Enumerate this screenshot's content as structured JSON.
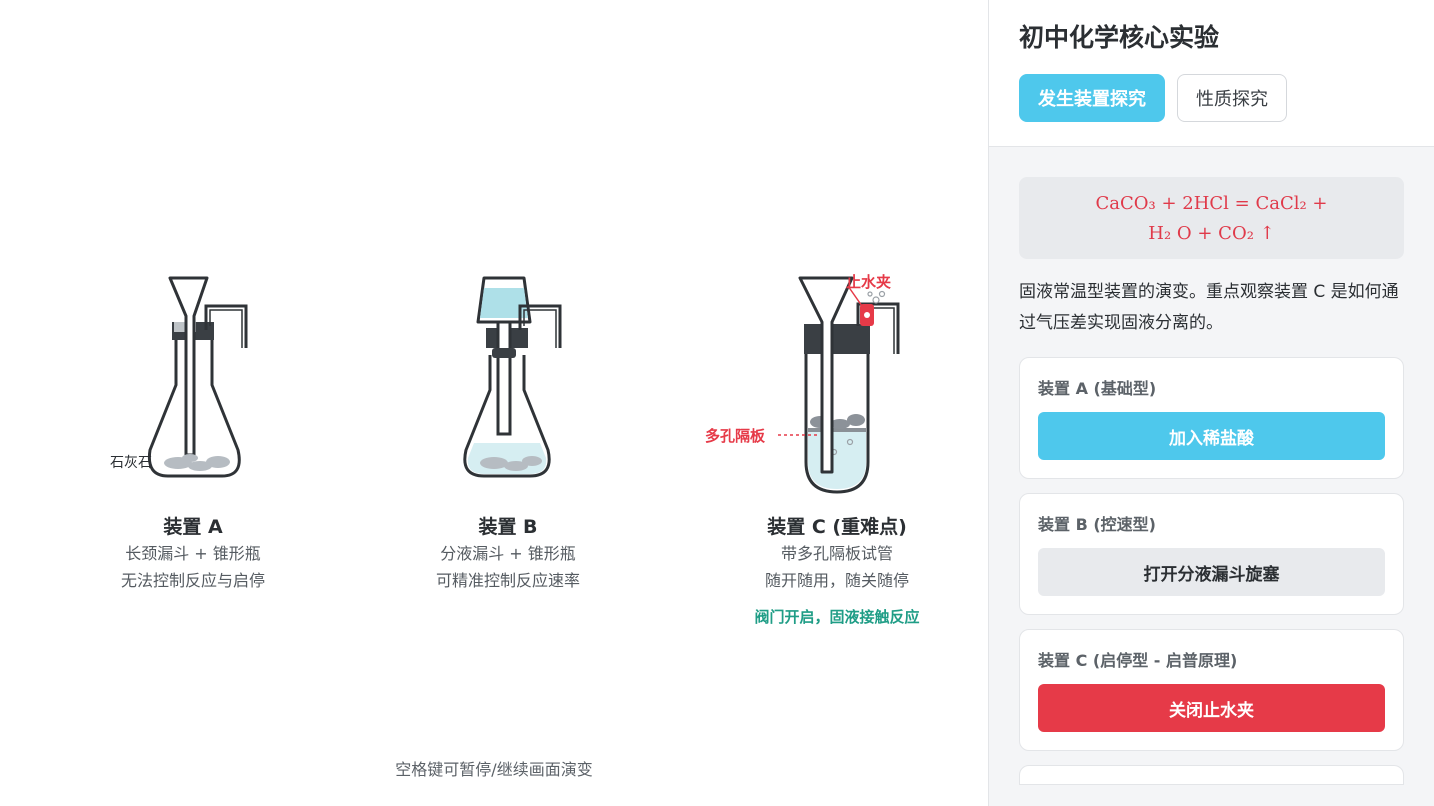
{
  "panel": {
    "title": "初中化学核心实验",
    "tabs": [
      {
        "label": "发生装置探究",
        "active": true
      },
      {
        "label": "性质探究",
        "active": false
      }
    ],
    "equation": {
      "line1": "CaCO₃  + 2HCl = CaCl₂  +",
      "line2": "H₂  O + CO₂  ↑"
    },
    "description": "固液常温型装置的演变。重点观察装置 C 是如何通过气压差实现固液分离的。",
    "cards": [
      {
        "label": "装置 A (基础型)",
        "button": "加入稀盐酸",
        "style": "blue"
      },
      {
        "label": "装置 B (控速型)",
        "button": "打开分液漏斗旋塞",
        "style": "grey"
      },
      {
        "label": "装置 C (启停型 - 启普原理)",
        "button": "关闭止水夹",
        "style": "red"
      }
    ]
  },
  "stage": {
    "devices": [
      {
        "title": "装置 A",
        "line1": "长颈漏斗 + 锥形瓶",
        "line2": "无法控制反应与启停",
        "status": ""
      },
      {
        "title": "装置 B",
        "line1": "分液漏斗 + 锥形瓶",
        "line2": "可精准控制反应速率",
        "status": ""
      },
      {
        "title": "装置 C (重难点)",
        "line1": "带多孔隔板试管",
        "line2": "随开随用，随关随停",
        "status": "阀门开启，固液接触反应"
      }
    ],
    "labels": {
      "limestone": "石灰石",
      "porous_plate": "多孔隔板",
      "clamp": "止水夹"
    },
    "hint": "空格键可暂停/继续画面演变"
  },
  "colors": {
    "accent": "#4ec8ec",
    "danger": "#e63a48",
    "success": "#1f9d86",
    "glass": "#2f3337",
    "liquid": "#d6eef2"
  }
}
